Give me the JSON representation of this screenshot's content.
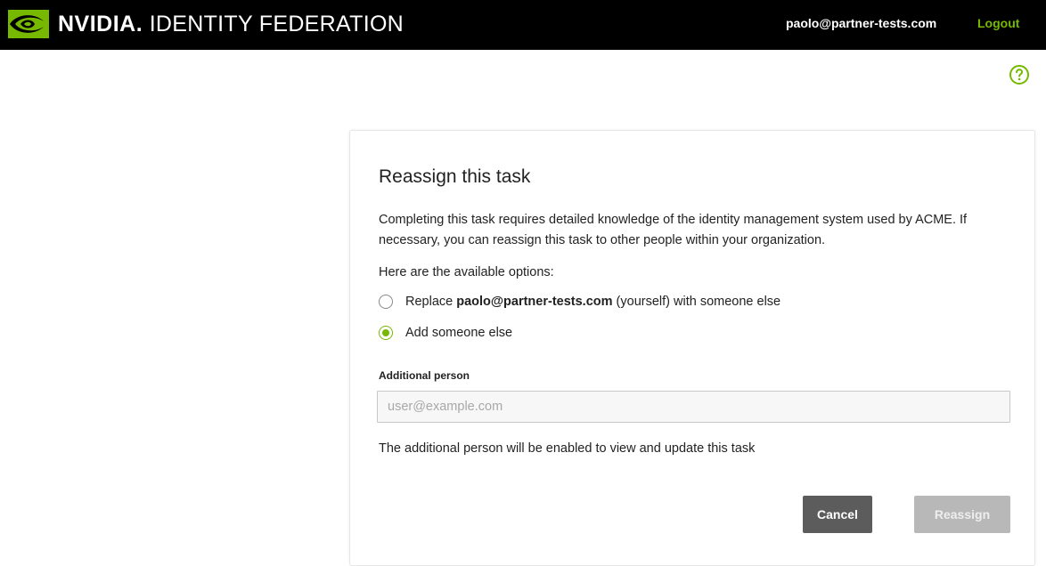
{
  "header": {
    "brand_name": "NVIDIA",
    "brand_dot": ".",
    "product_name": "IDENTITY FEDERATION",
    "user_email": "paolo@partner-tests.com",
    "logout_label": "Logout",
    "help_icon": "question-circle-icon"
  },
  "dialog": {
    "title": "Reassign this task",
    "description": "Completing this task requires detailed knowledge of the identity management system used by ACME. If necessary, you can reassign this task to other people within your organization.",
    "options_label": "Here are the available options:",
    "options": [
      {
        "prefix": "Replace ",
        "bold": "paolo@partner-tests.com",
        "suffix": " (yourself) with someone else",
        "selected": false
      },
      {
        "label": "Add someone else",
        "selected": true
      }
    ],
    "field_label": "Additional person",
    "field_value": "",
    "field_placeholder": "user@example.com",
    "field_help": "The additional person will be enabled to view and update this task",
    "cancel_label": "Cancel",
    "reassign_label": "Reassign",
    "reassign_enabled": false
  },
  "colors": {
    "brand_green": "#76b900",
    "header_bg": "#000000",
    "cancel_bg": "#5c5c5c",
    "reassign_disabled_bg": "#b8b8b8"
  }
}
